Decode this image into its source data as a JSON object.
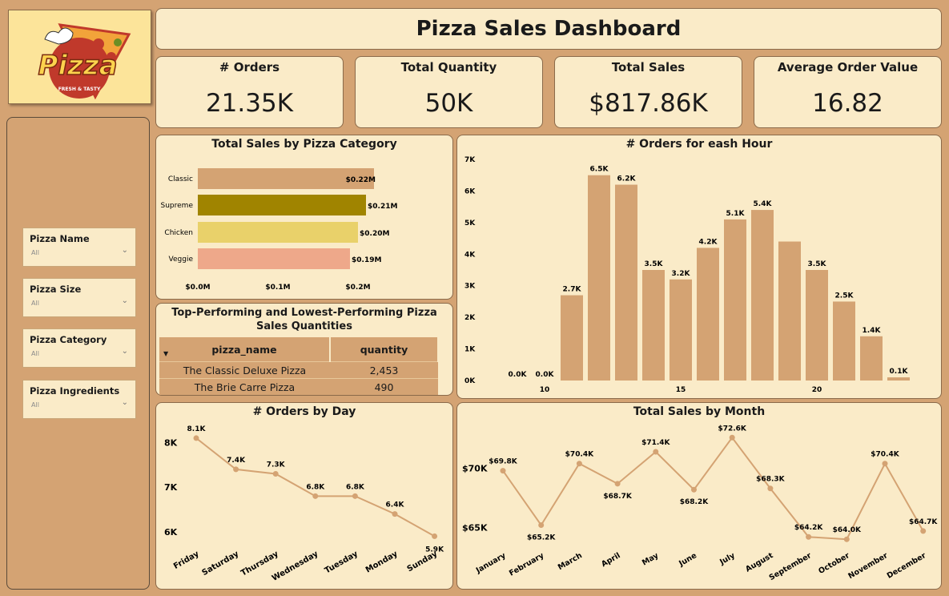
{
  "title": "Pizza Sales Dashboard",
  "logo": {
    "text": "Pizza",
    "tagline": "FRESH & TASTY"
  },
  "kpis": [
    {
      "label": "# Orders",
      "value": "21.35K"
    },
    {
      "label": "Total Quantity",
      "value": "50K"
    },
    {
      "label": "Total Sales",
      "value": "$817.86K"
    },
    {
      "label": "Average Order Value",
      "value": "16.82"
    }
  ],
  "slicers": [
    {
      "label": "Pizza Name",
      "value": "All"
    },
    {
      "label": "Pizza Size",
      "value": "All"
    },
    {
      "label": "Pizza Category",
      "value": "All"
    },
    {
      "label": "Pizza Ingredients",
      "value": "All"
    }
  ],
  "table": {
    "title": "Top-Performing and Lowest-Performing Pizza Sales Quantities",
    "columns": [
      "pizza_name",
      "quantity"
    ],
    "rows": [
      {
        "pizza_name": "The Classic Deluxe Pizza",
        "quantity": "2,453"
      },
      {
        "pizza_name": "The Brie Carre Pizza",
        "quantity": "490"
      }
    ]
  },
  "chart_data": [
    {
      "id": "category",
      "type": "bar",
      "orientation": "horizontal",
      "title": "Total Sales by Pizza Category",
      "categories": [
        "Classic",
        "Supreme",
        "Chicken",
        "Veggie"
      ],
      "values": [
        0.22,
        0.21,
        0.2,
        0.19
      ],
      "labels": [
        "$0.22M",
        "$0.21M",
        "$0.20M",
        "$0.19M"
      ],
      "colors": [
        "#d4a373",
        "#a08400",
        "#e9d16a",
        "#eea88a"
      ],
      "xticks": [
        "$0.0M",
        "$0.1M",
        "$0.2M"
      ],
      "xlim": [
        0,
        0.24
      ]
    },
    {
      "id": "hour",
      "type": "bar",
      "title": "# Orders for eash Hour",
      "x": [
        9,
        10,
        11,
        12,
        13,
        14,
        15,
        16,
        17,
        18,
        19,
        20,
        21,
        22,
        23
      ],
      "values": [
        0.0,
        0.0,
        2.7,
        6.5,
        6.2,
        3.5,
        3.2,
        4.2,
        5.1,
        5.4,
        4.4,
        3.5,
        2.5,
        1.4,
        0.1
      ],
      "labels": [
        "0.0K",
        "0.0K",
        "2.7K",
        "6.5K",
        "6.2K",
        "3.5K",
        "3.2K",
        "4.2K",
        "5.1K",
        "5.4K",
        "",
        "3.5K",
        "2.5K",
        "1.4K",
        "0.1K"
      ],
      "yticks": [
        "0K",
        "1K",
        "2K",
        "3K",
        "4K",
        "5K",
        "6K",
        "7K"
      ],
      "xticks": [
        "10",
        "15",
        "20"
      ],
      "ylim": [
        0,
        7
      ],
      "color": "#d4a373"
    },
    {
      "id": "day",
      "type": "line",
      "title": "# Orders by Day",
      "categories": [
        "Friday",
        "Saturday",
        "Thursday",
        "Wednesday",
        "Tuesday",
        "Monday",
        "Sunday"
      ],
      "values": [
        8.1,
        7.4,
        7.3,
        6.8,
        6.8,
        6.4,
        5.9
      ],
      "labels": [
        "8.1K",
        "7.4K",
        "7.3K",
        "6.8K",
        "6.8K",
        "6.4K",
        "5.9K"
      ],
      "yticks": [
        "6K",
        "7K",
        "8K"
      ],
      "ylim": [
        5.8,
        8.35
      ],
      "color": "#d4a373"
    },
    {
      "id": "month",
      "type": "line",
      "title": "Total Sales by Month",
      "categories": [
        "January",
        "February",
        "March",
        "April",
        "May",
        "June",
        "July",
        "August",
        "September",
        "October",
        "November",
        "December"
      ],
      "values": [
        69.8,
        65.2,
        70.4,
        68.7,
        71.4,
        68.2,
        72.6,
        68.3,
        64.2,
        64.0,
        70.4,
        64.7
      ],
      "labels": [
        "$69.8K",
        "$65.2K",
        "$70.4K",
        "$68.7K",
        "$71.4K",
        "$68.2K",
        "$72.6K",
        "$68.3K",
        "$64.2K",
        "$64.0K",
        "$70.4K",
        "$64.7K"
      ],
      "yticks": [
        "$65K",
        "$70K"
      ],
      "ylim": [
        63.2,
        73.5
      ],
      "color": "#d4a373"
    }
  ]
}
